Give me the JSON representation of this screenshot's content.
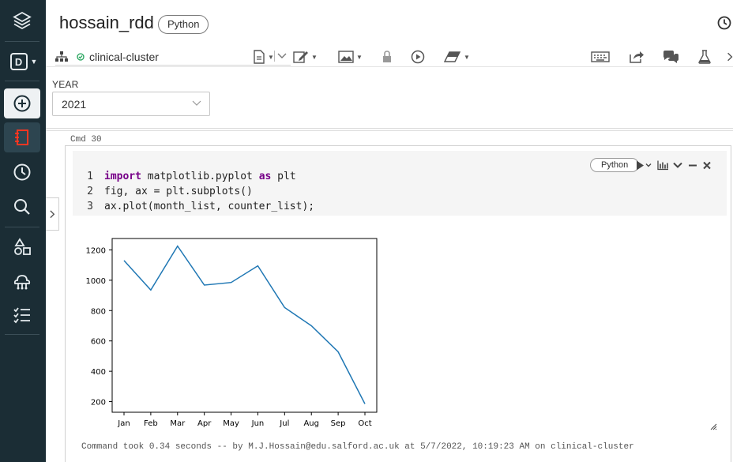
{
  "notebook": {
    "title": "hossain_rdd",
    "language": "Python"
  },
  "toolbar": {
    "cluster_name": "clinical-cluster"
  },
  "widget": {
    "label": "YEAR",
    "value": "2021"
  },
  "cell": {
    "cmd_label": "Cmd 30",
    "language": "Python",
    "code_lines": [
      {
        "num": "1",
        "kw1": "import",
        "mid": " matplotlib.pyplot ",
        "kw2": "as",
        "tail": " plt"
      },
      {
        "num": "2",
        "text": "fig, ax = plt.subplots()"
      },
      {
        "num": "3",
        "text": "ax.plot(month_list, counter_list);"
      }
    ],
    "status": "Command took 0.34 seconds -- by M.J.Hossain@edu.salford.ac.uk at 5/7/2022, 10:19:23 AM on clinical-cluster"
  },
  "chart_data": {
    "type": "line",
    "categories": [
      "Jan",
      "Feb",
      "Mar",
      "Apr",
      "May",
      "Jun",
      "Jul",
      "Aug",
      "Sep",
      "Oct"
    ],
    "values": [
      1130,
      935,
      1225,
      968,
      985,
      1095,
      820,
      700,
      528,
      185
    ],
    "yticks": [
      200,
      400,
      600,
      800,
      1000,
      1200
    ],
    "ylim": [
      130,
      1275
    ],
    "grid": false,
    "line_color": "#1f77b4",
    "title": "",
    "xlabel": "",
    "ylabel": ""
  },
  "colors": {
    "sidebar": "#1b2d35",
    "accent_red": "#ff3621",
    "success": "#22a35a"
  }
}
